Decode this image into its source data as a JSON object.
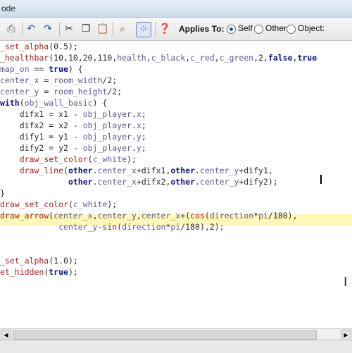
{
  "window": {
    "title_fragment": "ode"
  },
  "toolbar": {
    "icons": [
      "print-icon",
      "undo-icon",
      "redo-icon",
      "cut-icon",
      "copy-icon",
      "paste-icon",
      "search-icon",
      "check-syntax-icon",
      "help-icon"
    ],
    "applies_to_label": "Applies To:",
    "radios": [
      {
        "label": "Self",
        "selected": true
      },
      {
        "label": "Other",
        "selected": false
      },
      {
        "label": "Object:",
        "selected": false
      }
    ]
  },
  "code": {
    "lines": [
      [
        [
          "f",
          "_set_alpha"
        ],
        [
          "n",
          "(0.5);"
        ]
      ],
      [
        [
          "f",
          "_healthbar"
        ],
        [
          "n",
          "(10,10,20,110,"
        ],
        [
          "v",
          "health"
        ],
        [
          "n",
          ","
        ],
        [
          "v",
          "c_black"
        ],
        [
          "n",
          ","
        ],
        [
          "v",
          "c_red"
        ],
        [
          "n",
          ","
        ],
        [
          "v",
          "c_green"
        ],
        [
          "n",
          ",2,"
        ],
        [
          "k",
          "false"
        ],
        [
          "n",
          ","
        ],
        [
          "k",
          "true"
        ]
      ],
      [
        [
          "v",
          "map_on"
        ],
        [
          "n",
          " == "
        ],
        [
          "k",
          "true"
        ],
        [
          "n",
          ") {"
        ]
      ],
      [
        [
          "v",
          "center_x"
        ],
        [
          "n",
          " = "
        ],
        [
          "v",
          "room_width"
        ],
        [
          "n",
          "/2;"
        ]
      ],
      [
        [
          "v",
          "center_y"
        ],
        [
          "n",
          " = "
        ],
        [
          "v",
          "room_height"
        ],
        [
          "n",
          "/2;"
        ]
      ],
      [
        [
          "k",
          "with"
        ],
        [
          "n",
          "("
        ],
        [
          "v",
          "obj_wall_basic"
        ],
        [
          "n",
          ") {"
        ]
      ],
      [
        [
          "n",
          "    difx1 = x1 - "
        ],
        [
          "v",
          "obj_player"
        ],
        [
          "n",
          "."
        ],
        [
          "v",
          "x"
        ],
        [
          "n",
          ";"
        ]
      ],
      [
        [
          "n",
          "    difx2 = x2 - "
        ],
        [
          "v",
          "obj_player"
        ],
        [
          "n",
          "."
        ],
        [
          "v",
          "x"
        ],
        [
          "n",
          ";"
        ]
      ],
      [
        [
          "n",
          "    dify1 = y1 - "
        ],
        [
          "v",
          "obj_player"
        ],
        [
          "n",
          "."
        ],
        [
          "v",
          "y"
        ],
        [
          "n",
          ";"
        ]
      ],
      [
        [
          "n",
          "    dify2 = y2 - "
        ],
        [
          "v",
          "obj_player"
        ],
        [
          "n",
          "."
        ],
        [
          "v",
          "y"
        ],
        [
          "n",
          ";"
        ]
      ],
      [
        [
          "n",
          "    "
        ],
        [
          "f",
          "draw_set_color"
        ],
        [
          "n",
          "("
        ],
        [
          "v",
          "c_white"
        ],
        [
          "n",
          ");"
        ]
      ],
      [
        [
          "n",
          "    "
        ],
        [
          "f",
          "draw_line"
        ],
        [
          "n",
          "("
        ],
        [
          "k",
          "other"
        ],
        [
          "n",
          "."
        ],
        [
          "v",
          "center_x"
        ],
        [
          "n",
          "+difx1,"
        ],
        [
          "k",
          "other"
        ],
        [
          "n",
          "."
        ],
        [
          "v",
          "center_y"
        ],
        [
          "n",
          "+dify1,"
        ]
      ],
      [
        [
          "n",
          "              "
        ],
        [
          "k",
          "other"
        ],
        [
          "n",
          "."
        ],
        [
          "v",
          "center_x"
        ],
        [
          "n",
          "+difx2,"
        ],
        [
          "k",
          "other"
        ],
        [
          "n",
          "."
        ],
        [
          "v",
          "center_y"
        ],
        [
          "n",
          "+dify2);"
        ]
      ],
      [
        [
          "n",
          "}"
        ]
      ],
      [
        [
          "f",
          "draw_set_color"
        ],
        [
          "n",
          "("
        ],
        [
          "v",
          "c_white"
        ],
        [
          "n",
          ");"
        ]
      ],
      [
        [
          "f",
          "draw_arrow"
        ],
        [
          "n",
          "("
        ],
        [
          "v",
          "center_x"
        ],
        [
          "n",
          ","
        ],
        [
          "v",
          "center_y"
        ],
        [
          "n",
          ","
        ],
        [
          "v",
          "center_x"
        ],
        [
          "n",
          "+("
        ],
        [
          "f",
          "cos"
        ],
        [
          "n",
          "("
        ],
        [
          "v",
          "direction"
        ],
        [
          "n",
          "*"
        ],
        [
          "v",
          "pi"
        ],
        [
          "n",
          "/180"
        ],
        [
          "n",
          ")"
        ],
        [
          "n",
          ","
        ]
      ],
      [
        [
          "n",
          "            "
        ],
        [
          "v",
          "center_y"
        ],
        [
          "n",
          "-"
        ],
        [
          "f",
          "sin"
        ],
        [
          "n",
          "("
        ],
        [
          "v",
          "direction"
        ],
        [
          "n",
          "*"
        ],
        [
          "v",
          "pi"
        ],
        [
          "n",
          "/180),2);"
        ]
      ],
      [
        [
          "n",
          ""
        ]
      ],
      [
        [
          "n",
          ""
        ]
      ],
      [
        [
          "f",
          "_set_alpha"
        ],
        [
          "n",
          "(1.0);"
        ]
      ],
      [
        [
          "f",
          "et_hidden"
        ],
        [
          "n",
          "("
        ],
        [
          "k",
          "true"
        ],
        [
          "n",
          ");"
        ]
      ]
    ]
  }
}
